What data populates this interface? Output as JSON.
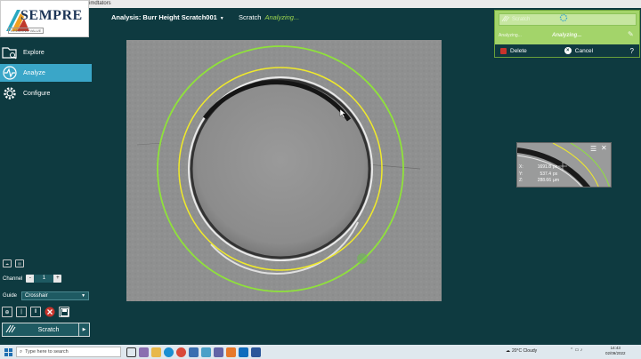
{
  "window": {
    "title": "imdtators"
  },
  "logo": {
    "word": "SEMPRE",
    "tagline": "CREATING VALUE"
  },
  "nav": [
    {
      "label": "Explore",
      "icon": "folder-search-icon"
    },
    {
      "label": "Analyze",
      "icon": "pulse-icon",
      "active": true
    },
    {
      "label": "Configure",
      "icon": "gear-icon"
    }
  ],
  "left_controls": {
    "channel_label": "Channel",
    "channel_minus": "-",
    "channel_value": "1",
    "channel_plus": "+",
    "guide_label": "Guide",
    "guide_value": "Crosshair",
    "scratch_button": "Scratch"
  },
  "header": {
    "analysis": "Analysis: Burr Height Scratch001",
    "scratch_label": "Scratch",
    "scratch_status": "Analyzing..."
  },
  "panel": {
    "row_label": "Scratch",
    "analyzing_left": "Analyzing...",
    "analyzing_right": "Analyzing...",
    "delete": "Delete",
    "cancel": "Cancel",
    "help": "?"
  },
  "inset": {
    "x_label": "X:",
    "x_value": "1691.8",
    "x_unit": "px",
    "y_label": "Y:",
    "y_value": "537.4",
    "y_unit": "px",
    "z_label": "Z:",
    "z_value": "288.66",
    "z_unit": "µm"
  },
  "taskbar": {
    "search_placeholder": "Type here to search",
    "weather": "20°C Cloudy",
    "time": "14:43",
    "date": "02/09/2022"
  },
  "colors": {
    "background": "#0e3a40",
    "accent": "#3aa6c8",
    "panel_green": "#a3d46a",
    "circle_green": "#8fe23a",
    "circle_yellow": "#f0ea2a"
  }
}
